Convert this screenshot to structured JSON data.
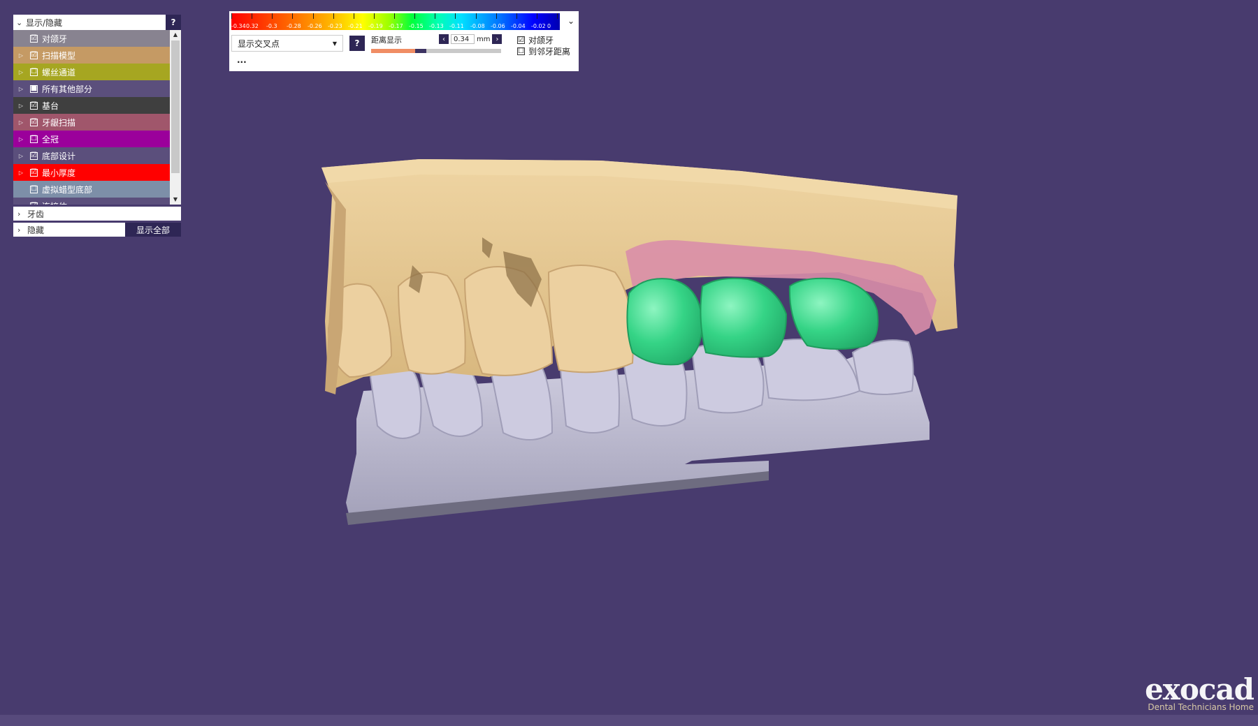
{
  "panel": {
    "title": "显示/隐藏",
    "help": "?",
    "items": [
      {
        "label": "对颌牙",
        "checked": "☑",
        "color": "#888390",
        "expand": ""
      },
      {
        "label": "扫描模型",
        "checked": "☑",
        "color": "#c59a64",
        "expand": "▷"
      },
      {
        "label": "螺丝通道",
        "checked": "☐",
        "color": "#a6a621",
        "expand": "▷"
      },
      {
        "label": "所有其他部分",
        "checked": "■",
        "color": "#5b4f7c",
        "expand": "▷"
      },
      {
        "label": "基台",
        "checked": "☑",
        "color": "#3f3f3f",
        "expand": "▷"
      },
      {
        "label": "牙龈扫描",
        "checked": "☑",
        "color": "#a0566b",
        "expand": "▷"
      },
      {
        "label": "全冠",
        "checked": "☐",
        "color": "#9b009b",
        "expand": "▷"
      },
      {
        "label": "底部设计",
        "checked": "☑",
        "color": "#5b4f7c",
        "expand": "▷"
      },
      {
        "label": "最小厚度",
        "checked": "☑",
        "color": "#ff0000",
        "expand": "▷"
      },
      {
        "label": "虚拟蜡型底部",
        "checked": "☐",
        "color": "#7d8fa8",
        "expand": ""
      },
      {
        "label": "连接体",
        "checked": "☑",
        "color": "#5b4f7c",
        "expand": "▷"
      }
    ],
    "teeth_label": "牙齿",
    "hidden_label": "隐藏",
    "show_all_label": "显示全部"
  },
  "toolbar": {
    "scale_labels": [
      "-0.34",
      "0.32",
      "-0.3",
      "-0.28",
      "-0.26",
      "-0.23",
      "-0.21",
      "-0.19",
      "-0.17",
      "-0.15",
      "-0.13",
      "-0.11",
      "-0.08",
      "-0.06",
      "-0.04",
      "-0.02",
      "0"
    ],
    "dropdown_value": "显示交叉点",
    "help": "?",
    "distance_label": "距离显示",
    "distance_value": "0.34",
    "unit": "mm",
    "distance_fraction": 0.34,
    "check_antagonist": "对颌牙",
    "check_antagonist_state": "☑",
    "check_adjacent": "到邻牙距离",
    "check_adjacent_state": "☐",
    "more": "..."
  },
  "logo": {
    "brand": "exocad",
    "subtitle": "Dental Technicians Home"
  },
  "colors": {
    "background": "#483b6e",
    "upper_model": "#e8cc99",
    "lower_model": "#c4c2d6",
    "crown": "#3dd68c",
    "gingiva": "#d88ea7"
  }
}
